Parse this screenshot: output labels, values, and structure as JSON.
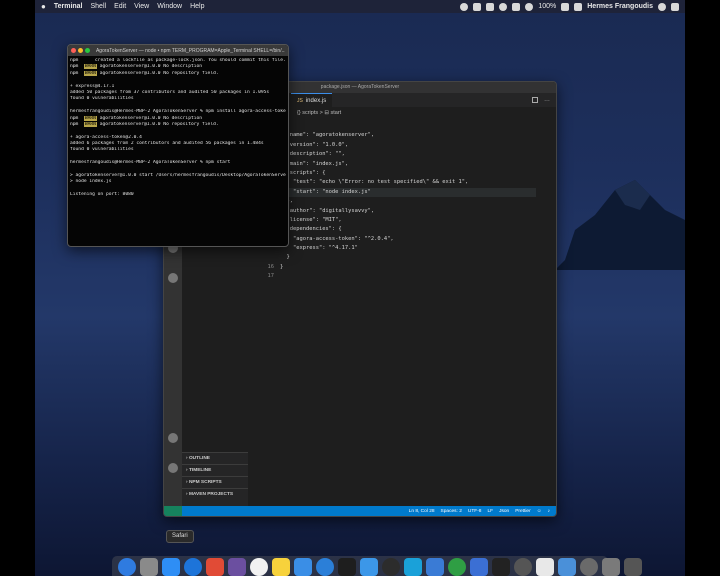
{
  "menubar": {
    "apple": "",
    "items": [
      "Terminal",
      "Shell",
      "Edit",
      "View",
      "Window",
      "Help"
    ],
    "battery": "100%",
    "user": "Hermes Frangoudis"
  },
  "terminal": {
    "title": "AgoraTokenServer — node • npm TERM_PROGRAM=Apple_Terminal SHELL=/bin/...",
    "lines": [
      {
        "pre": "npm  ",
        "tag": "",
        "text": "    created a lockfile as package-lock.json. You should commit this file."
      },
      {
        "pre": "npm  ",
        "tag": "WARN",
        "text": " agoratokenserver@1.0.0 No description"
      },
      {
        "pre": "npm  ",
        "tag": "WARN",
        "text": " agoratokenserver@1.0.0 No repository field."
      },
      {
        "pre": "",
        "tag": "",
        "text": ""
      },
      {
        "pre": "",
        "tag": "",
        "text": "+ express@4.17.1"
      },
      {
        "pre": "",
        "tag": "",
        "text": "added 50 packages from 37 contributors and audited 50 packages in 1.095s"
      },
      {
        "pre": "",
        "tag": "",
        "text": "found 0 vulnerabilities"
      },
      {
        "pre": "",
        "tag": "",
        "text": ""
      },
      {
        "pre": "",
        "tag": "",
        "text": "hermesfrangoudis@Hermes-MBP-2 AgoraTokenServer % npm install agora-access-token"
      },
      {
        "pre": "npm  ",
        "tag": "WARN",
        "text": " agoratokenserver@1.0.0 No description"
      },
      {
        "pre": "npm  ",
        "tag": "WARN",
        "text": " agoratokenserver@1.0.0 No repository field."
      },
      {
        "pre": "",
        "tag": "",
        "text": ""
      },
      {
        "pre": "",
        "tag": "",
        "text": "+ agora-access-token@2.0.4"
      },
      {
        "pre": "",
        "tag": "",
        "text": "added 6 packages from 2 contributors and audited 56 packages in 1.484s"
      },
      {
        "pre": "",
        "tag": "",
        "text": "found 0 vulnerabilities"
      },
      {
        "pre": "",
        "tag": "",
        "text": ""
      },
      {
        "pre": "",
        "tag": "",
        "text": "hermesfrangoudis@Hermes-MBP-2 AgoraTokenServer % npm start"
      },
      {
        "pre": "",
        "tag": "",
        "text": ""
      },
      {
        "pre": "",
        "tag": "",
        "text": "> agoratokenserver@1.0.0 start /Users/hermesfrangoudis/Desktop/AgoraTokenServer"
      },
      {
        "pre": "",
        "tag": "",
        "text": "> node index.js"
      },
      {
        "pre": "",
        "tag": "",
        "text": ""
      },
      {
        "pre": "",
        "tag": "",
        "text": "Listening on port: 8080"
      }
    ]
  },
  "vscode": {
    "title": "package.json — AgoraTokenServer",
    "tab": "index.js",
    "breadcrumb": "{} scripts > ⊟ start",
    "code": [
      {
        "n": "",
        "t": "{"
      },
      {
        "n": "",
        "t": "  \"name\": \"agoratokenserver\","
      },
      {
        "n": "",
        "t": "  \"version\": \"1.0.0\","
      },
      {
        "n": "",
        "t": "  \"description\": \"\","
      },
      {
        "n": "",
        "t": "  \"main\": \"index.js\","
      },
      {
        "n": "",
        "t": "  \"scripts\": {"
      },
      {
        "n": "",
        "t": "    \"test\": \"echo \\\"Error: no test specified\\\" && exit 1\","
      },
      {
        "n": "",
        "t": "    \"start\": \"node index.js\""
      },
      {
        "n": "",
        "t": "  },"
      },
      {
        "n": "",
        "t": "  \"author\": \"digitallysavvy\","
      },
      {
        "n": "",
        "t": "  \"license\": \"MIT\","
      },
      {
        "n": "",
        "t": "  \"dependencies\": {"
      },
      {
        "n": "",
        "t": "    \"agora-access-token\": \"^2.0.4\","
      },
      {
        "n": "",
        "t": "    \"express\": \"^4.17.1\""
      },
      {
        "n": "",
        "t": "  }"
      },
      {
        "n": "16",
        "t": "}"
      },
      {
        "n": "17",
        "t": ""
      }
    ],
    "sidebar_sections": [
      "OUTLINE",
      "TIMELINE",
      "NPM SCRIPTS",
      "MAVEN PROJECTS"
    ],
    "status": [
      "Ln 8, Col 28",
      "Spaces: 2",
      "UTF-8",
      "LF",
      "Json",
      "Prettier"
    ]
  },
  "tooltip": "Safari",
  "dock": {
    "colors": [
      "#2f7be0",
      "#8a8a8a",
      "#2e8ef5",
      "#1d74d9",
      "#e14b36",
      "#6b4fa0",
      "#f2f2f2",
      "#f7d23c",
      "#3a8ee6",
      "#2b7fd8",
      "#1e1e1e",
      "#3c97e8",
      "#2c2c2c",
      "#1aa1d9",
      "#3a7bd5",
      "#2f9e44",
      "#3b6fd4",
      "#222222",
      "#555555",
      "#e8e8e8",
      "#4a90d9",
      "#6a6a6a",
      "#7a7a7a",
      "#555555"
    ]
  }
}
